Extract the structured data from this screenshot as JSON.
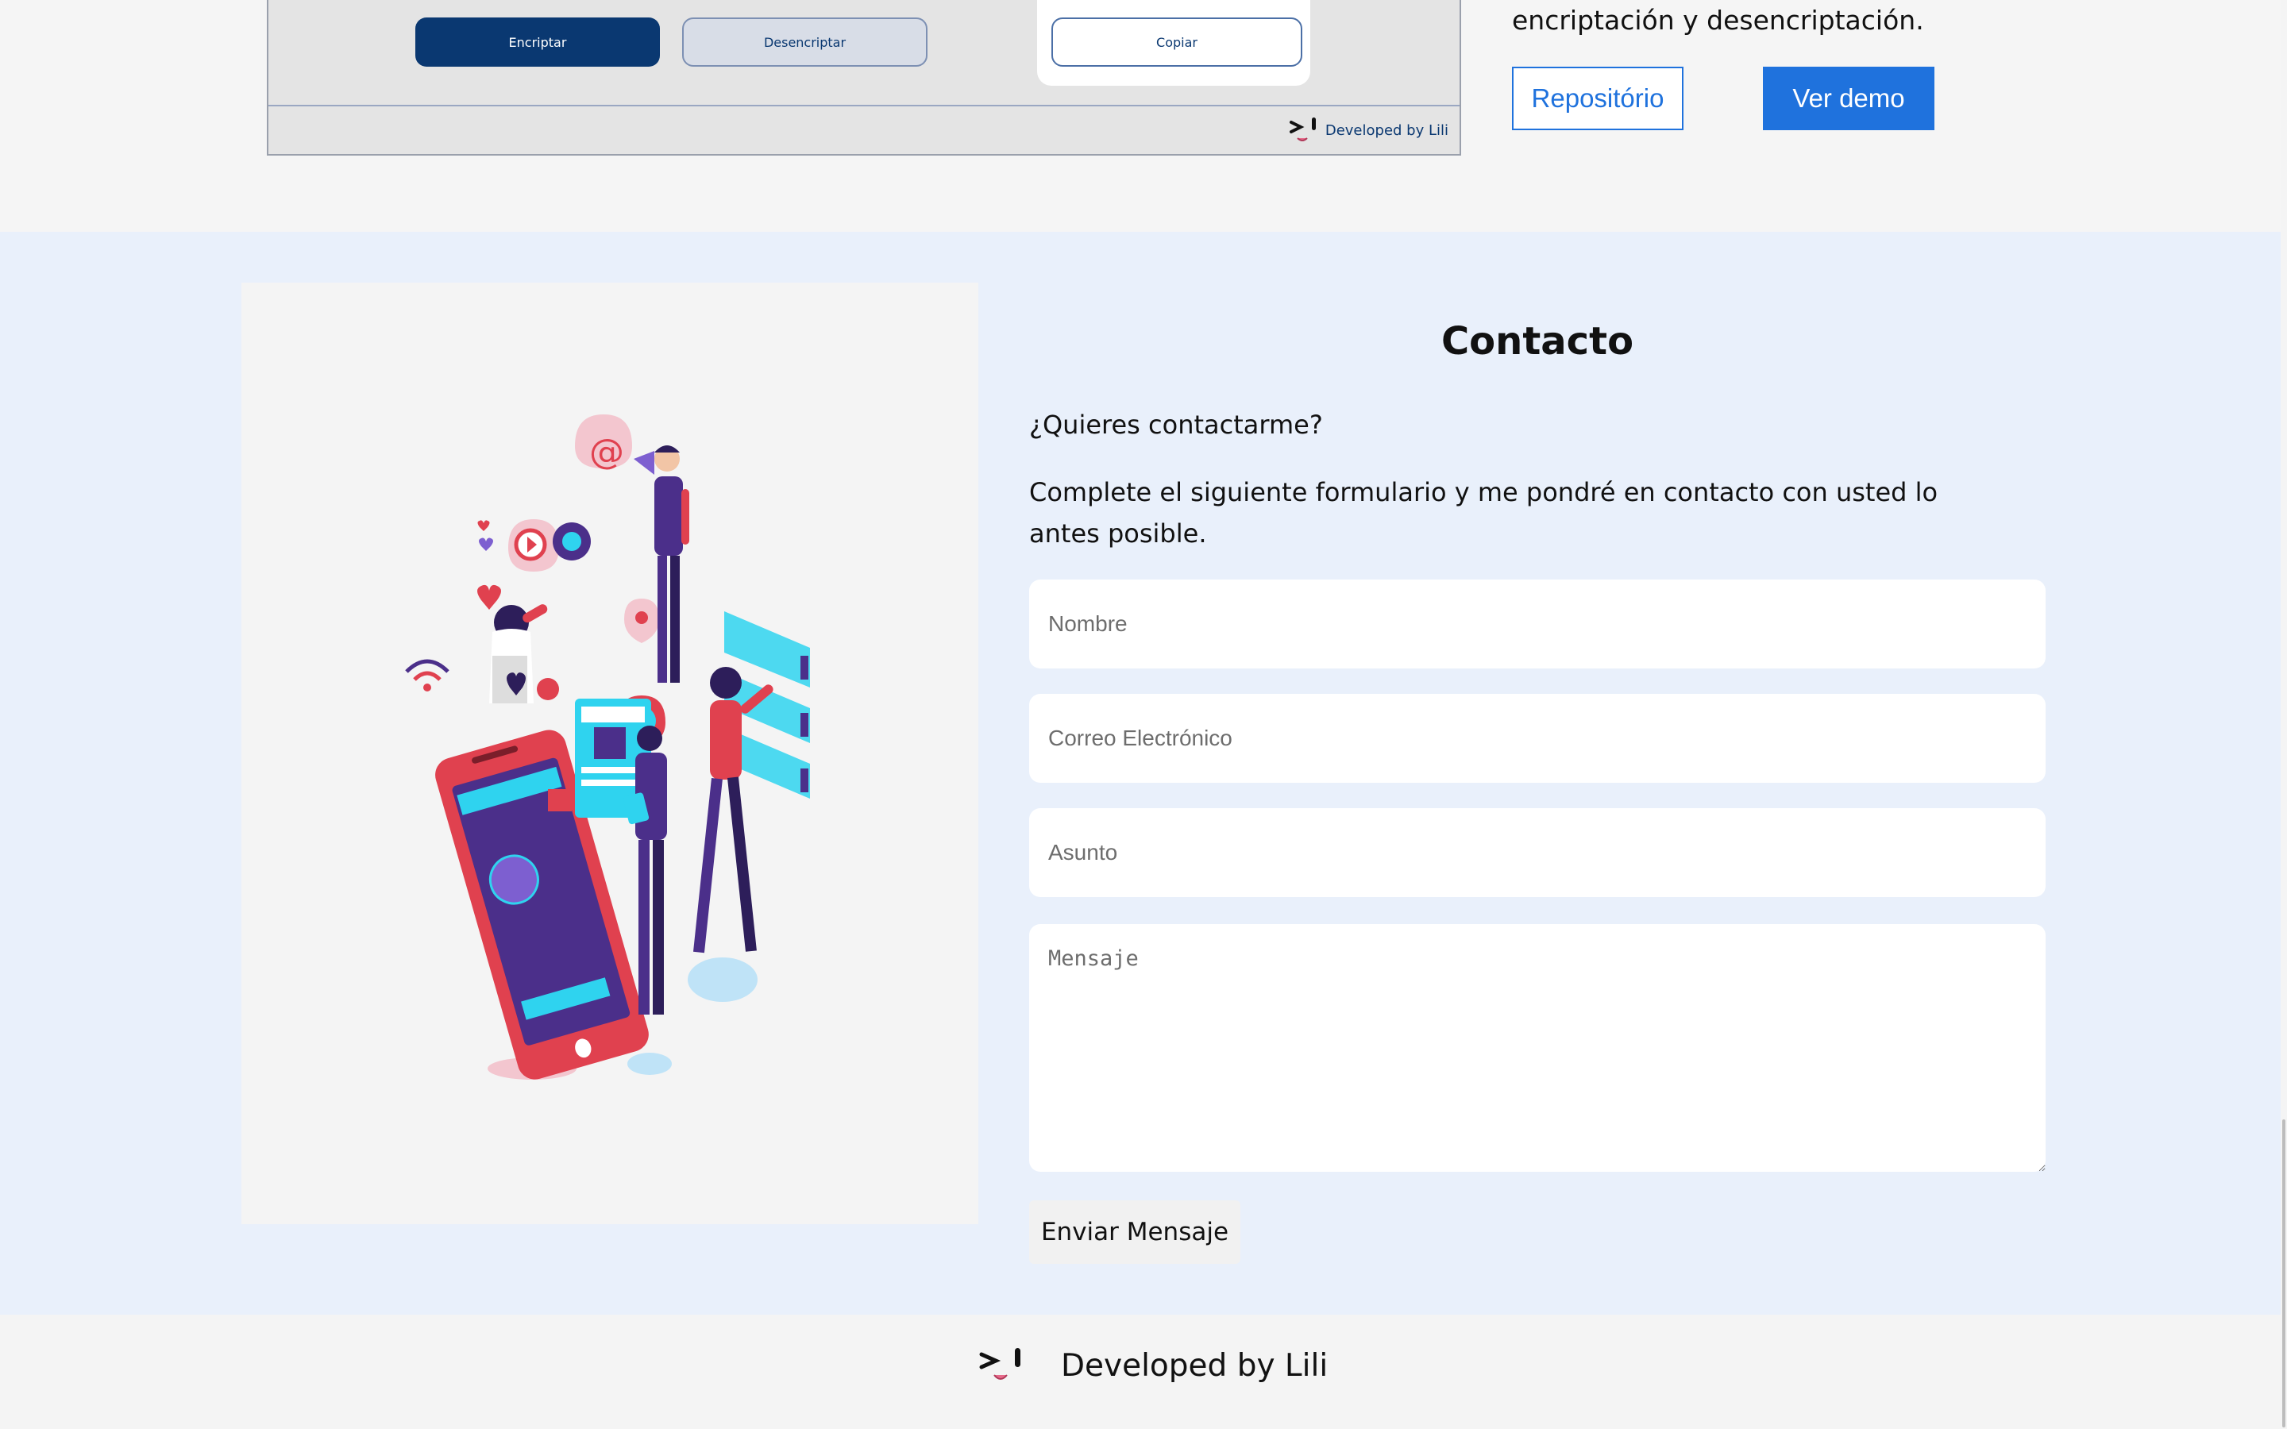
{
  "project": {
    "encrypt_label": "Encriptar",
    "decrypt_label": "Desencriptar",
    "copy_label": "Copiar",
    "preview_footer_text": "Developed by Lili",
    "description_tail": "encriptación y desencriptación.",
    "repo_label": "Repositório",
    "demo_label": "Ver demo"
  },
  "contact": {
    "title": "Contacto",
    "question": "¿Quieres contactarme?",
    "description": "Complete el siguiente formulario y me pondré en contacto con usted lo antes posible.",
    "fields": {
      "name_placeholder": "Nombre",
      "email_placeholder": "Correo Electrónico",
      "subject_placeholder": "Asunto",
      "message_placeholder": "Mensaje"
    },
    "send_label": "Enviar Mensaje"
  },
  "footer": {
    "text": "Developed by Lili"
  },
  "colors": {
    "brand_dark": "#0a3871",
    "accent_blue": "#1f72dd",
    "contact_bg": "#e9f0fb"
  }
}
